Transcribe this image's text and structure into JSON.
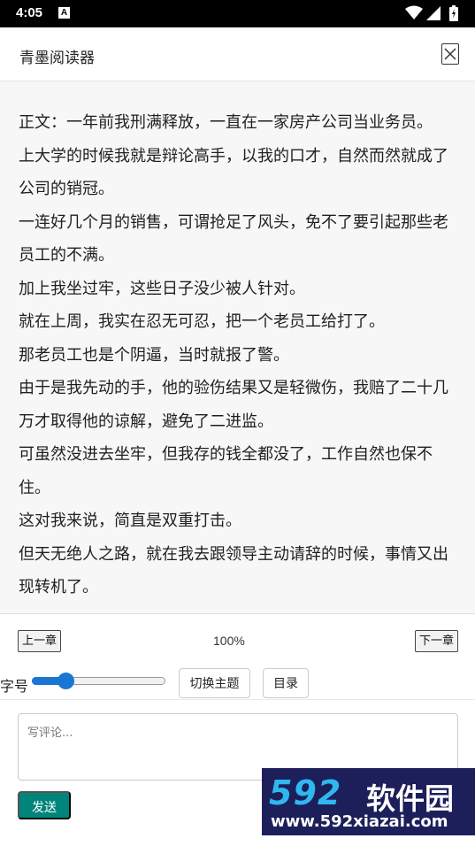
{
  "status_bar": {
    "time": "4:05",
    "notification_badge": "A"
  },
  "header": {
    "title": "青墨阅读器",
    "close_label": "关闭"
  },
  "content": {
    "paragraphs": [
      "正文：一年前我刑满释放，一直在一家房产公司当业务员。",
      "上大学的时候我就是辩论高手，以我的口才，自然而然就成了公司的销冠。",
      "一连好几个月的销售，可谓抢足了风头，免不了要引起那些老员工的不满。",
      "加上我坐过牢，这些日子没少被人针对。",
      "就在上周，我实在忍无可忍，把一个老员工给打了。",
      "那老员工也是个阴逼，当时就报了警。",
      "由于是我先动的手，他的验伤结果又是轻微伤，我赔了二十几万才取得他的谅解，避免了二进监。",
      "可虽然没进去坐牢，但我存的钱全都没了，工作自然也保不住。",
      "这对我来说，简直是双重打击。",
      "但天无绝人之路，就在我去跟领导主动请辞的时候，事情又出现转机了。"
    ]
  },
  "nav": {
    "prev_label": "上一章",
    "progress": "100%",
    "next_label": "下一章"
  },
  "settings": {
    "font_size_label": "字号",
    "font_size_level": 0.15,
    "theme_button": "切换主题",
    "toc_button": "目录"
  },
  "comment": {
    "placeholder": "写评论...",
    "send_label": "发送"
  },
  "watermark": {
    "brand_num": "592",
    "brand_text": "软件园",
    "url": "www.592xiazai.com"
  },
  "colors": {
    "accent": "#1976d2",
    "send_button": "#00857a",
    "content_bg": "#f7f7f7"
  }
}
